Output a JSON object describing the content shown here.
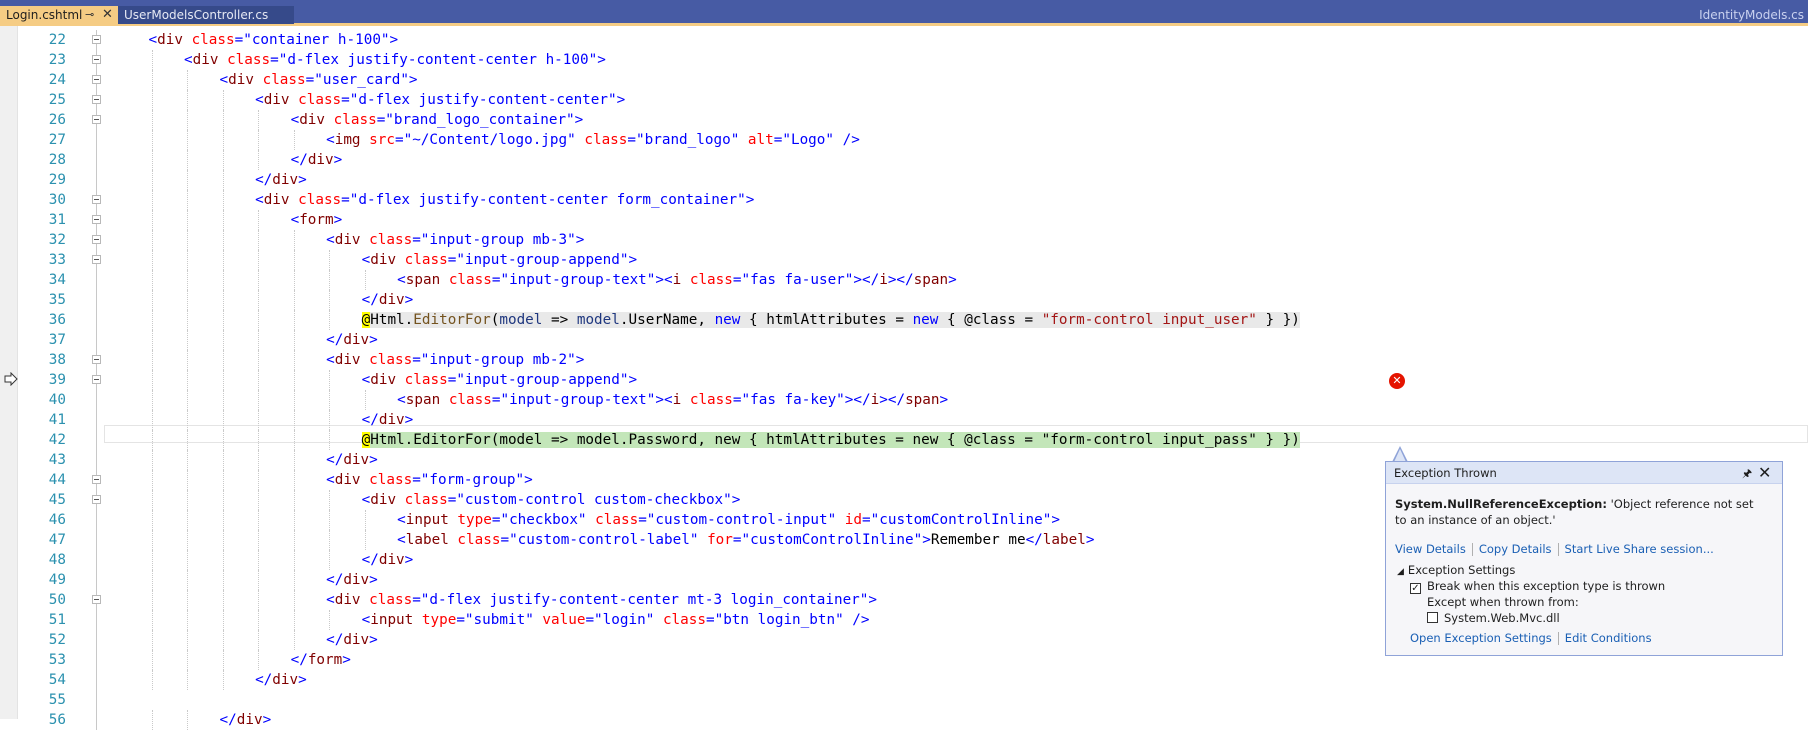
{
  "tabs": {
    "active": "Login.cshtml",
    "active_pin": "⊸",
    "active_close": "✕",
    "inactive": "UserModelsController.cs",
    "right": "IdentityModels.cs"
  },
  "code_lines": [
    {
      "n": "22",
      "fold": true,
      "indent": 4,
      "html": "<span class=\"v\">&lt;</span><span class=\"t\">div</span> <span class=\"a\">class</span><span class=\"v\">=\"container h-100\"&gt;</span>"
    },
    {
      "n": "23",
      "fold": true,
      "indent": 8,
      "html": "<span class=\"v\">&lt;</span><span class=\"t\">div</span> <span class=\"a\">class</span><span class=\"v\">=\"d-flex justify-content-center h-100\"&gt;</span>"
    },
    {
      "n": "24",
      "fold": true,
      "indent": 12,
      "html": "<span class=\"v\">&lt;</span><span class=\"t\">div</span> <span class=\"a\">class</span><span class=\"v\">=\"user_card\"&gt;</span>"
    },
    {
      "n": "25",
      "fold": true,
      "indent": 16,
      "html": "<span class=\"v\">&lt;</span><span class=\"t\">div</span> <span class=\"a\">class</span><span class=\"v\">=\"d-flex justify-content-center\"&gt;</span>"
    },
    {
      "n": "26",
      "fold": true,
      "indent": 20,
      "html": "<span class=\"v\">&lt;</span><span class=\"t\">div</span> <span class=\"a\">class</span><span class=\"v\">=\"brand_logo_container\"&gt;</span>"
    },
    {
      "n": "27",
      "fold": false,
      "indent": 24,
      "html": "<span class=\"v\">&lt;</span><span class=\"t\">img</span> <span class=\"a\">src</span><span class=\"v\">=\"~/Content/logo.jpg\"</span> <span class=\"a\">class</span><span class=\"v\">=\"brand_logo\"</span> <span class=\"a\">alt</span><span class=\"v\">=\"Logo\" /&gt;</span>"
    },
    {
      "n": "28",
      "fold": false,
      "indent": 20,
      "html": "<span class=\"v\">&lt;/</span><span class=\"t\">div</span><span class=\"v\">&gt;</span>"
    },
    {
      "n": "29",
      "fold": false,
      "indent": 16,
      "html": "<span class=\"v\">&lt;/</span><span class=\"t\">div</span><span class=\"v\">&gt;</span>"
    },
    {
      "n": "30",
      "fold": true,
      "indent": 16,
      "html": "<span class=\"v\">&lt;</span><span class=\"t\">div</span> <span class=\"a\">class</span><span class=\"v\">=\"d-flex justify-content-center form_container\"&gt;</span>"
    },
    {
      "n": "31",
      "fold": true,
      "indent": 20,
      "html": "<span class=\"v\">&lt;</span><span class=\"t\">form</span><span class=\"v\">&gt;</span>"
    },
    {
      "n": "32",
      "fold": true,
      "indent": 24,
      "html": "<span class=\"v\">&lt;</span><span class=\"t\">div</span> <span class=\"a\">class</span><span class=\"v\">=\"input-group mb-3\"&gt;</span>"
    },
    {
      "n": "33",
      "fold": true,
      "indent": 28,
      "html": "<span class=\"v\">&lt;</span><span class=\"t\">div</span> <span class=\"a\">class</span><span class=\"v\">=\"input-group-append\"&gt;</span>"
    },
    {
      "n": "34",
      "fold": false,
      "indent": 32,
      "html": "<span class=\"v\">&lt;</span><span class=\"t\">span</span> <span class=\"a\">class</span><span class=\"v\">=\"input-group-text\"&gt;&lt;</span><span class=\"t\">i</span> <span class=\"a\">class</span><span class=\"v\">=\"fas fa-user\"&gt;&lt;/</span><span class=\"t\">i</span><span class=\"v\">&gt;&lt;/</span><span class=\"t\">span</span><span class=\"v\">&gt;</span>"
    },
    {
      "n": "35",
      "fold": false,
      "indent": 28,
      "html": "<span class=\"v\">&lt;/</span><span class=\"t\">div</span><span class=\"v\">&gt;</span>"
    },
    {
      "n": "36",
      "fold": false,
      "indent": 28,
      "html": "<span class=\"razor\">@</span><span class=\"hl-gray\"><span>Html.</span><span class=\"m\">EditorFor</span>(<span class=\"id\">model</span> =&gt; <span class=\"id\">model</span>.UserName, <span class=\"k\">new</span> { htmlAttributes = <span class=\"k\">new</span> { @class = <span class=\"s\">\"form-control input_user\"</span> } })</span>"
    },
    {
      "n": "37",
      "fold": false,
      "indent": 24,
      "html": "<span class=\"v\">&lt;/</span><span class=\"t\">div</span><span class=\"v\">&gt;</span>"
    },
    {
      "n": "38",
      "fold": true,
      "indent": 24,
      "html": "<span class=\"v\">&lt;</span><span class=\"t\">div</span> <span class=\"a\">class</span><span class=\"v\">=\"input-group mb-2\"&gt;</span>"
    },
    {
      "n": "39",
      "fold": true,
      "indent": 28,
      "html": "<span class=\"v\">&lt;</span><span class=\"t\">div</span> <span class=\"a\">class</span><span class=\"v\">=\"input-group-append\"&gt;</span>"
    },
    {
      "n": "40",
      "fold": false,
      "indent": 32,
      "html": "<span class=\"v\">&lt;</span><span class=\"t\">span</span> <span class=\"a\">class</span><span class=\"v\">=\"input-group-text\"&gt;&lt;</span><span class=\"t\">i</span> <span class=\"a\">class</span><span class=\"v\">=\"fas fa-key\"&gt;&lt;/</span><span class=\"t\">i</span><span class=\"v\">&gt;&lt;/</span><span class=\"t\">span</span><span class=\"v\">&gt;</span>"
    },
    {
      "n": "41",
      "fold": false,
      "indent": 28,
      "html": "<span class=\"v\">&lt;/</span><span class=\"t\">div</span><span class=\"v\">&gt;</span>"
    },
    {
      "n": "42",
      "fold": false,
      "indent": 28,
      "current": true,
      "html": "<span class=\"razor\">@</span><span class=\"hl-green\">Html.EditorFor(model =&gt; model.Password, new { htmlAttributes = new { @class = \"form-control input_pass\" } })</span>"
    },
    {
      "n": "43",
      "fold": false,
      "indent": 24,
      "html": "<span class=\"v\">&lt;/</span><span class=\"t\">div</span><span class=\"v\">&gt;</span>"
    },
    {
      "n": "44",
      "fold": true,
      "indent": 24,
      "html": "<span class=\"v\">&lt;</span><span class=\"t\">div</span> <span class=\"a\">class</span><span class=\"v\">=\"form-group\"&gt;</span>"
    },
    {
      "n": "45",
      "fold": true,
      "indent": 28,
      "html": "<span class=\"v\">&lt;</span><span class=\"t\">div</span> <span class=\"a\">class</span><span class=\"v\">=\"custom-control custom-checkbox\"&gt;</span>"
    },
    {
      "n": "46",
      "fold": false,
      "indent": 32,
      "html": "<span class=\"v\">&lt;</span><span class=\"t\">input</span> <span class=\"a\">type</span><span class=\"v\">=\"checkbox\"</span> <span class=\"a\">class</span><span class=\"v\">=\"custom-control-input\"</span> <span class=\"a\">id</span><span class=\"v\">=\"customControlInline\"&gt;</span>"
    },
    {
      "n": "47",
      "fold": false,
      "indent": 32,
      "html": "<span class=\"v\">&lt;</span><span class=\"t\">label</span> <span class=\"a\">class</span><span class=\"v\">=\"custom-control-label\"</span> <span class=\"a\">for</span><span class=\"v\">=\"customControlInline\"&gt;</span>Remember me<span class=\"v\">&lt;/</span><span class=\"t\">label</span><span class=\"v\">&gt;</span>"
    },
    {
      "n": "48",
      "fold": false,
      "indent": 28,
      "html": "<span class=\"v\">&lt;/</span><span class=\"t\">div</span><span class=\"v\">&gt;</span>"
    },
    {
      "n": "49",
      "fold": false,
      "indent": 24,
      "html": "<span class=\"v\">&lt;/</span><span class=\"t\">div</span><span class=\"v\">&gt;</span>"
    },
    {
      "n": "50",
      "fold": true,
      "indent": 24,
      "html": "<span class=\"v\">&lt;</span><span class=\"t\">div</span> <span class=\"a\">class</span><span class=\"v\">=\"d-flex justify-content-center mt-3 login_container\"&gt;</span>"
    },
    {
      "n": "51",
      "fold": false,
      "indent": 28,
      "html": "<span class=\"v\">&lt;</span><span class=\"t\">input</span> <span class=\"a\">type</span><span class=\"v\">=\"submit\"</span> <span class=\"a\">value</span><span class=\"v\">=\"login\"</span> <span class=\"a\">class</span><span class=\"v\">=\"btn login_btn\" /&gt;</span>"
    },
    {
      "n": "52",
      "fold": false,
      "indent": 24,
      "html": "<span class=\"v\">&lt;/</span><span class=\"t\">div</span><span class=\"v\">&gt;</span>"
    },
    {
      "n": "53",
      "fold": false,
      "indent": 20,
      "html": "<span class=\"v\">&lt;/</span><span class=\"t\">form</span><span class=\"v\">&gt;</span>"
    },
    {
      "n": "54",
      "fold": false,
      "indent": 16,
      "html": "<span class=\"v\">&lt;/</span><span class=\"t\">div</span><span class=\"v\">&gt;</span>"
    },
    {
      "n": "55",
      "fold": false,
      "indent": 0,
      "html": ""
    },
    {
      "n": "56",
      "fold": false,
      "indent": 12,
      "html": "<span class=\"v\">&lt;/</span><span class=\"t\">div</span><span class=\"v\">&gt;</span>"
    }
  ],
  "error_icon": {
    "symbol": "✕",
    "name": "error-icon"
  },
  "popup": {
    "title": "Exception Thrown",
    "pin": "📌",
    "close": "✕",
    "exception_type": "System.NullReferenceException:",
    "exception_message": " 'Object reference not set to an instance of an object.'",
    "links": [
      "View Details",
      "Copy Details",
      "Start Live Share session..."
    ],
    "settings_header": "Exception Settings",
    "settings_arrow": "◢",
    "break_label": "Break when this exception type is thrown",
    "break_checked": "✓",
    "except_label": "Except when thrown from:",
    "dll_label": "System.Web.Mvc.dll",
    "bottom_links": [
      "Open Exception Settings",
      "Edit Conditions"
    ]
  },
  "colors": {
    "tab_active": "#f5cc84",
    "tab_bar": "#475ba4",
    "line_numbers": "#2b91af",
    "current_line_highlight": "#c3e6b9",
    "error": "#e51400"
  }
}
